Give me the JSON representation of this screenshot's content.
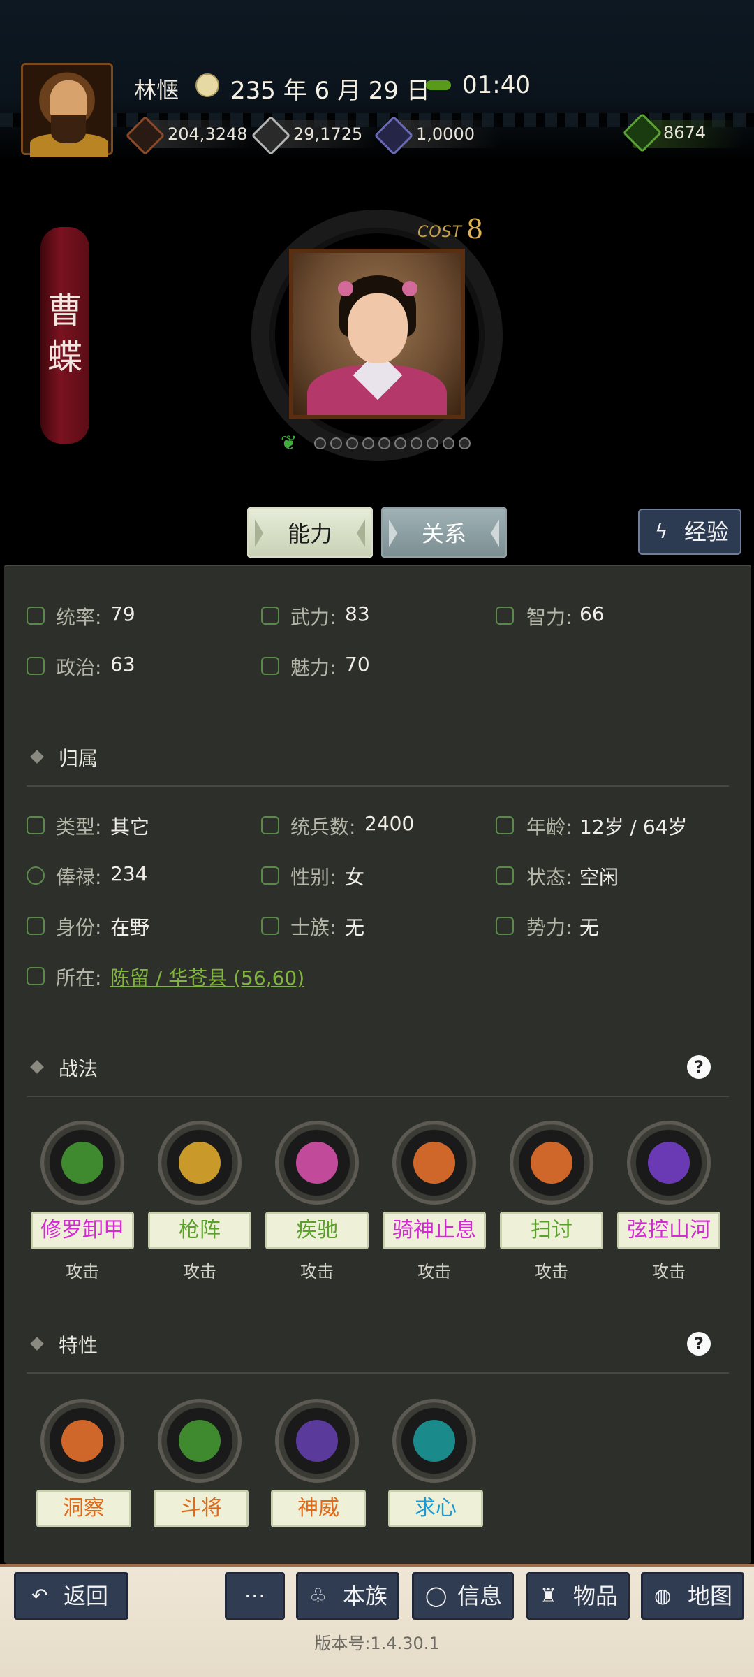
{
  "header": {
    "player_name": "林惬",
    "date": "235 年 6 月 29 日",
    "time": "01:40",
    "resources": [
      {
        "icon": "money-icon",
        "value": "204,3248",
        "color": "#8a4a2a"
      },
      {
        "icon": "food-icon",
        "value": "29,1725",
        "color": "#b4b4b4"
      },
      {
        "icon": "soldier-icon",
        "value": "1,0000",
        "color": "#6a6ab4"
      },
      {
        "icon": "bag-icon",
        "value": "8674",
        "color": "#5aa032"
      }
    ]
  },
  "character": {
    "name_chars": [
      "曹",
      "蝶"
    ],
    "cost_label": "COST",
    "cost_value": "8"
  },
  "tabs": {
    "ability": "能力",
    "relation": "关系",
    "experience": "经验"
  },
  "stats": [
    {
      "label": "统率:",
      "value": "79"
    },
    {
      "label": "武力:",
      "value": "83"
    },
    {
      "label": "智力:",
      "value": "66"
    },
    {
      "label": "政治:",
      "value": "63"
    },
    {
      "label": "魅力:",
      "value": "70"
    }
  ],
  "belonging": {
    "title": "归属",
    "rows": [
      {
        "label": "类型:",
        "value": "其它"
      },
      {
        "label": "统兵数:",
        "value": "2400"
      },
      {
        "label": "年龄:",
        "value": "12岁 / 64岁"
      },
      {
        "label": "俸禄:",
        "value": "234"
      },
      {
        "label": "性别:",
        "value": "女"
      },
      {
        "label": "状态:",
        "value": "空闲"
      },
      {
        "label": "身份:",
        "value": "在野"
      },
      {
        "label": "士族:",
        "value": "无"
      },
      {
        "label": "势力:",
        "value": "无"
      }
    ],
    "location_label": "所在:",
    "location_value": "陈留 / 华苍县 (56,60)"
  },
  "tactics": {
    "title": "战法",
    "help": "?",
    "items": [
      {
        "name": "修罗卸甲",
        "type": "攻击",
        "color": "#d42ad4",
        "icon": "demon-warrior-icon",
        "glyph": "#3f8a2f"
      },
      {
        "name": "枪阵",
        "type": "攻击",
        "color": "#5aa02a",
        "icon": "spear-shield-icon",
        "glyph": "#c99a2a"
      },
      {
        "name": "疾驰",
        "type": "攻击",
        "color": "#5aa02a",
        "icon": "arrows-icon",
        "glyph": "#c24a9a"
      },
      {
        "name": "骑神止息",
        "type": "攻击",
        "color": "#d42ad4",
        "icon": "horse-spear-icon",
        "glyph": "#d0672a"
      },
      {
        "name": "扫讨",
        "type": "攻击",
        "color": "#5aa02a",
        "icon": "sweep-icon",
        "glyph": "#d0672a"
      },
      {
        "name": "弦控山河",
        "type": "攻击",
        "color": "#d42ad4",
        "icon": "bow-fan-icon",
        "glyph": "#6a3ab4"
      }
    ]
  },
  "traits": {
    "title": "特性",
    "help": "?",
    "items": [
      {
        "name": "洞察",
        "color": "#e06a1a",
        "icon": "eye-icon",
        "glyph": "#d0672a"
      },
      {
        "name": "斗将",
        "color": "#e06a1a",
        "icon": "mask-icon",
        "glyph": "#3f8a2f"
      },
      {
        "name": "神威",
        "color": "#e06a1a",
        "icon": "hat-figure-icon",
        "glyph": "#5a3a9a"
      },
      {
        "name": "求心",
        "color": "#1a9ad4",
        "icon": "heart-spade-icon",
        "glyph": "#1a8a8a"
      }
    ]
  },
  "bottom_nav": {
    "back": "返回",
    "more": "···",
    "clan": "本族",
    "info": "信息",
    "items": "物品",
    "map": "地图",
    "version": "版本号:1.4.30.1"
  }
}
